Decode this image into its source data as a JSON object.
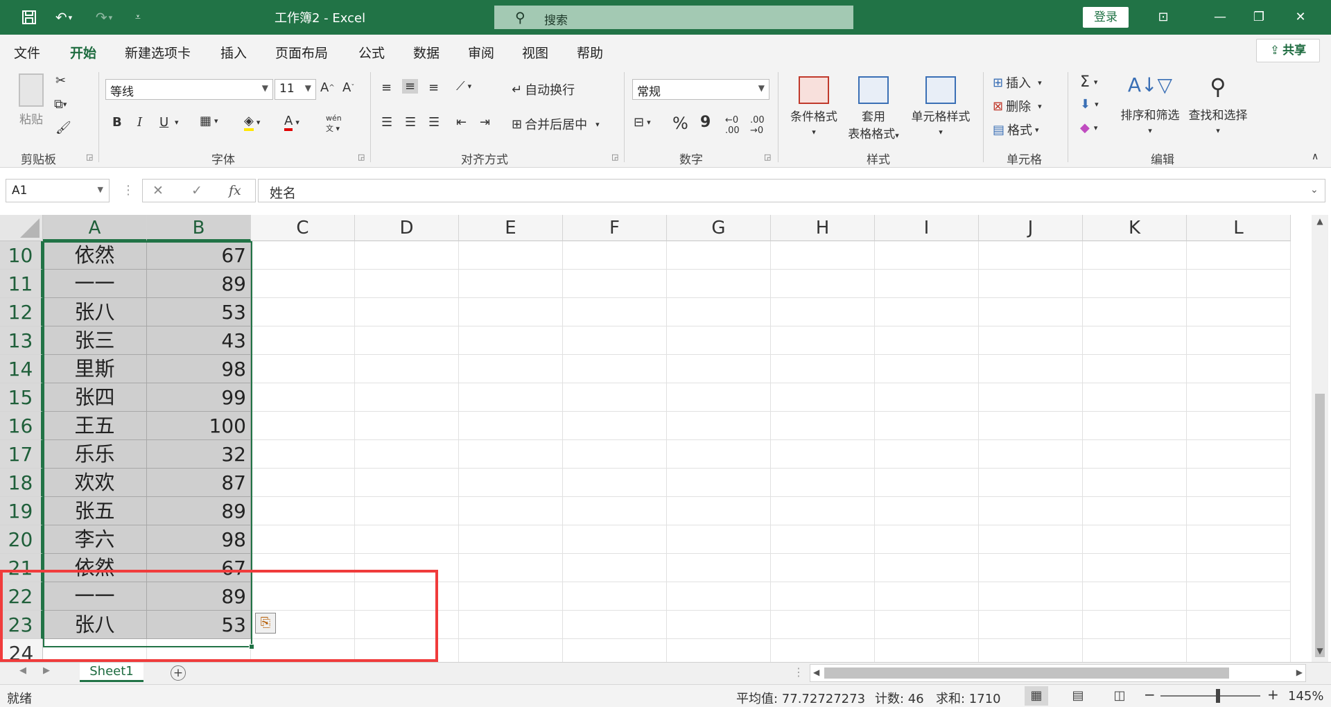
{
  "titlebar": {
    "title": "工作簿2  -  Excel",
    "search_placeholder": "搜索",
    "login_label": "登录",
    "save_icon": "save-icon",
    "undo_icon": "undo-icon",
    "redo_icon": "redo-icon"
  },
  "menu": {
    "tabs": [
      "文件",
      "开始",
      "新建选项卡",
      "插入",
      "页面布局",
      "公式",
      "数据",
      "审阅",
      "视图",
      "帮助"
    ],
    "active": "开始",
    "share_label": "共享"
  },
  "ribbon": {
    "clipboard": {
      "label": "剪贴板",
      "paste": "粘贴"
    },
    "font": {
      "label": "字体",
      "font_name": "等线",
      "font_size": "11",
      "bold": "B",
      "italic": "I",
      "underline": "U"
    },
    "alignment": {
      "label": "对齐方式",
      "wrap": "自动换行",
      "merge": "合并后居中"
    },
    "number": {
      "label": "数字",
      "format": "常规",
      "percent": "%",
      "comma": "9"
    },
    "styles": {
      "label": "样式",
      "conditional": "条件格式",
      "table_line1": "套用",
      "table_line2": "表格格式",
      "cell_styles": "单元格样式"
    },
    "cells": {
      "label": "单元格",
      "insert": "插入",
      "delete": "删除",
      "format": "格式"
    },
    "editing": {
      "label": "编辑",
      "sort": "排序和筛选",
      "find": "查找和选择"
    }
  },
  "formula_bar": {
    "name_box": "A1",
    "formula": "姓名"
  },
  "grid": {
    "columns": [
      "A",
      "B",
      "C",
      "D",
      "E",
      "F",
      "G",
      "H",
      "I",
      "J",
      "K",
      "L"
    ],
    "rows": [
      {
        "num": "10",
        "name": "依然",
        "score": "67"
      },
      {
        "num": "11",
        "name": "一一",
        "score": "89"
      },
      {
        "num": "12",
        "name": "张八",
        "score": "53"
      },
      {
        "num": "13",
        "name": "张三",
        "score": "43"
      },
      {
        "num": "14",
        "name": "里斯",
        "score": "98"
      },
      {
        "num": "15",
        "name": "张四",
        "score": "99"
      },
      {
        "num": "16",
        "name": "王五",
        "score": "100"
      },
      {
        "num": "17",
        "name": "乐乐",
        "score": "32"
      },
      {
        "num": "18",
        "name": "欢欢",
        "score": "87"
      },
      {
        "num": "19",
        "name": "张五",
        "score": "89"
      },
      {
        "num": "20",
        "name": "李六",
        "score": "98"
      },
      {
        "num": "21",
        "name": "依然",
        "score": "67"
      },
      {
        "num": "22",
        "name": "一一",
        "score": "89"
      },
      {
        "num": "23",
        "name": "张八",
        "score": "53"
      },
      {
        "num": "24",
        "name": "",
        "score": ""
      }
    ]
  },
  "sheets": {
    "active": "Sheet1"
  },
  "status": {
    "ready": "就绪",
    "average": "平均值: 77.72727273",
    "count": "计数: 46",
    "sum": "求和: 1710",
    "zoom": "145%",
    "zoom_minus": "−",
    "zoom_plus": "+"
  },
  "colors": {
    "accent": "#217346",
    "highlight_box": "#f03c3c"
  }
}
